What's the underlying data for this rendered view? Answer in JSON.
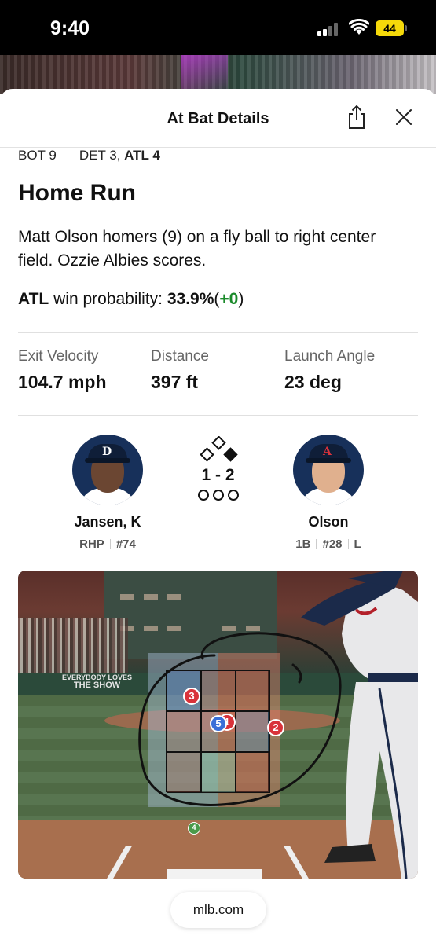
{
  "status_bar": {
    "time": "9:40",
    "battery": "44"
  },
  "header": {
    "title": "At Bat Details"
  },
  "inning": {
    "half": "BOT 9",
    "away_score": "DET 3,",
    "home_score": "ATL 4"
  },
  "result": {
    "title": "Home Run",
    "description": "Matt Olson homers (9) on a fly ball to right center field. Ozzie Albies scores."
  },
  "win_probability": {
    "team": "ATL",
    "label": "win probability:",
    "value": "33.9%",
    "open": "(",
    "delta": "+0",
    "close": ")"
  },
  "stats": [
    {
      "label": "Exit Velocity",
      "value": "104.7 mph"
    },
    {
      "label": "Distance",
      "value": "397 ft"
    },
    {
      "label": "Launch Angle",
      "value": "23 deg"
    }
  ],
  "pitcher": {
    "name": "Jansen, K",
    "position": "RHP",
    "number": "#74",
    "cap_logo": "D"
  },
  "batter": {
    "name": "Olson",
    "position": "1B",
    "number": "#28",
    "bats": "L",
    "cap_logo": "A"
  },
  "count": {
    "balls_strikes": "1 - 2",
    "outs": 0,
    "bases_occupied": [
      "first"
    ]
  },
  "pitches": [
    {
      "number": "3",
      "color": "#d9323a"
    },
    {
      "number": "5",
      "color": "#3a6fd8"
    },
    {
      "number": "2",
      "color": "#d9323a"
    },
    {
      "number": "1",
      "color": "#d9323a"
    },
    {
      "number": "4",
      "color": "#4a9a4a"
    }
  ],
  "stadium_wall": {
    "line1": "EVERYBODY LOVES",
    "line2": "THE SHOW"
  },
  "source": {
    "label": "mlb.com"
  },
  "colors": {
    "delta_positive": "#1a8a2a",
    "navy": "#17305a"
  }
}
